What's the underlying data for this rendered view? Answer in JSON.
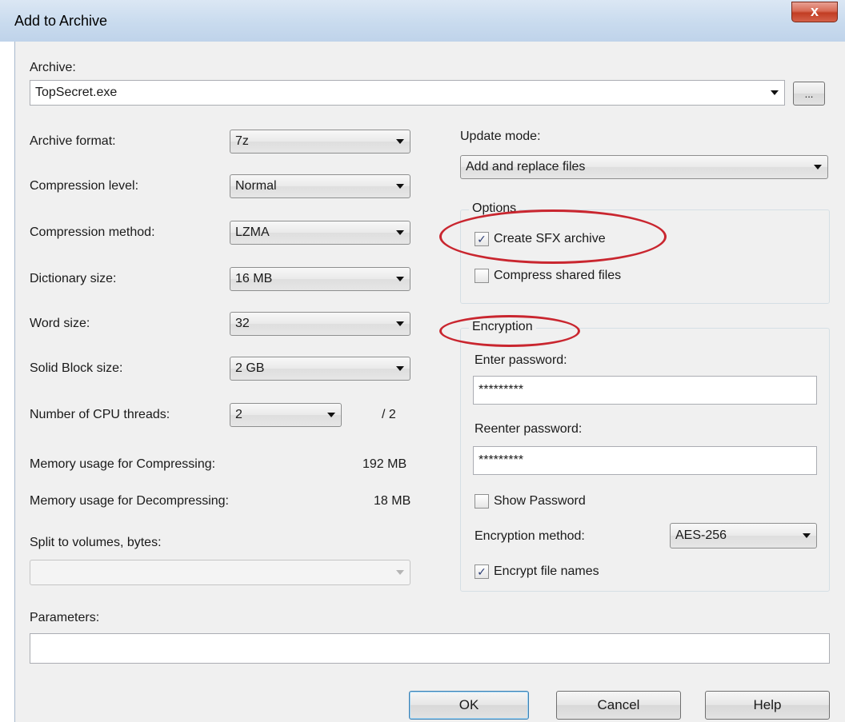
{
  "window": {
    "title": "Add to Archive",
    "close_label": "x"
  },
  "archive": {
    "label": "Archive:",
    "value": "TopSecret.exe",
    "browse_label": "..."
  },
  "left": {
    "archive_format": {
      "label": "Archive format:",
      "value": "7z"
    },
    "compression_level": {
      "label": "Compression level:",
      "value": "Normal"
    },
    "compression_method": {
      "label": "Compression method:",
      "value": "LZMA"
    },
    "dictionary_size": {
      "label": "Dictionary size:",
      "value": "16 MB"
    },
    "word_size": {
      "label": "Word size:",
      "value": "32"
    },
    "solid_block_size": {
      "label": "Solid Block size:",
      "value": "2 GB"
    },
    "cpu_threads": {
      "label": "Number of CPU threads:",
      "value": "2",
      "total": "/ 2"
    },
    "memory_compressing": {
      "label": "Memory usage for Compressing:",
      "value": "192 MB"
    },
    "memory_decompressing": {
      "label": "Memory usage for Decompressing:",
      "value": "18 MB"
    },
    "split_volumes": {
      "label": "Split to volumes, bytes:",
      "value": ""
    }
  },
  "right": {
    "update_mode": {
      "label": "Update mode:",
      "value": "Add and replace files"
    },
    "options": {
      "legend": "Options",
      "create_sfx": {
        "label": "Create SFX archive",
        "checked": true
      },
      "compress_shared": {
        "label": "Compress shared files",
        "checked": false
      }
    },
    "encryption": {
      "legend": "Encryption",
      "enter_password_label": "Enter password:",
      "enter_password_value": "*********",
      "reenter_password_label": "Reenter password:",
      "reenter_password_value": "*********",
      "show_password": {
        "label": "Show Password",
        "checked": false
      },
      "method": {
        "label": "Encryption method:",
        "value": "AES-256"
      },
      "encrypt_names": {
        "label": "Encrypt file names",
        "checked": true
      }
    }
  },
  "parameters": {
    "label": "Parameters:",
    "value": ""
  },
  "buttons": {
    "ok": "OK",
    "cancel": "Cancel",
    "help": "Help"
  },
  "annotation_color": "#c9262f"
}
